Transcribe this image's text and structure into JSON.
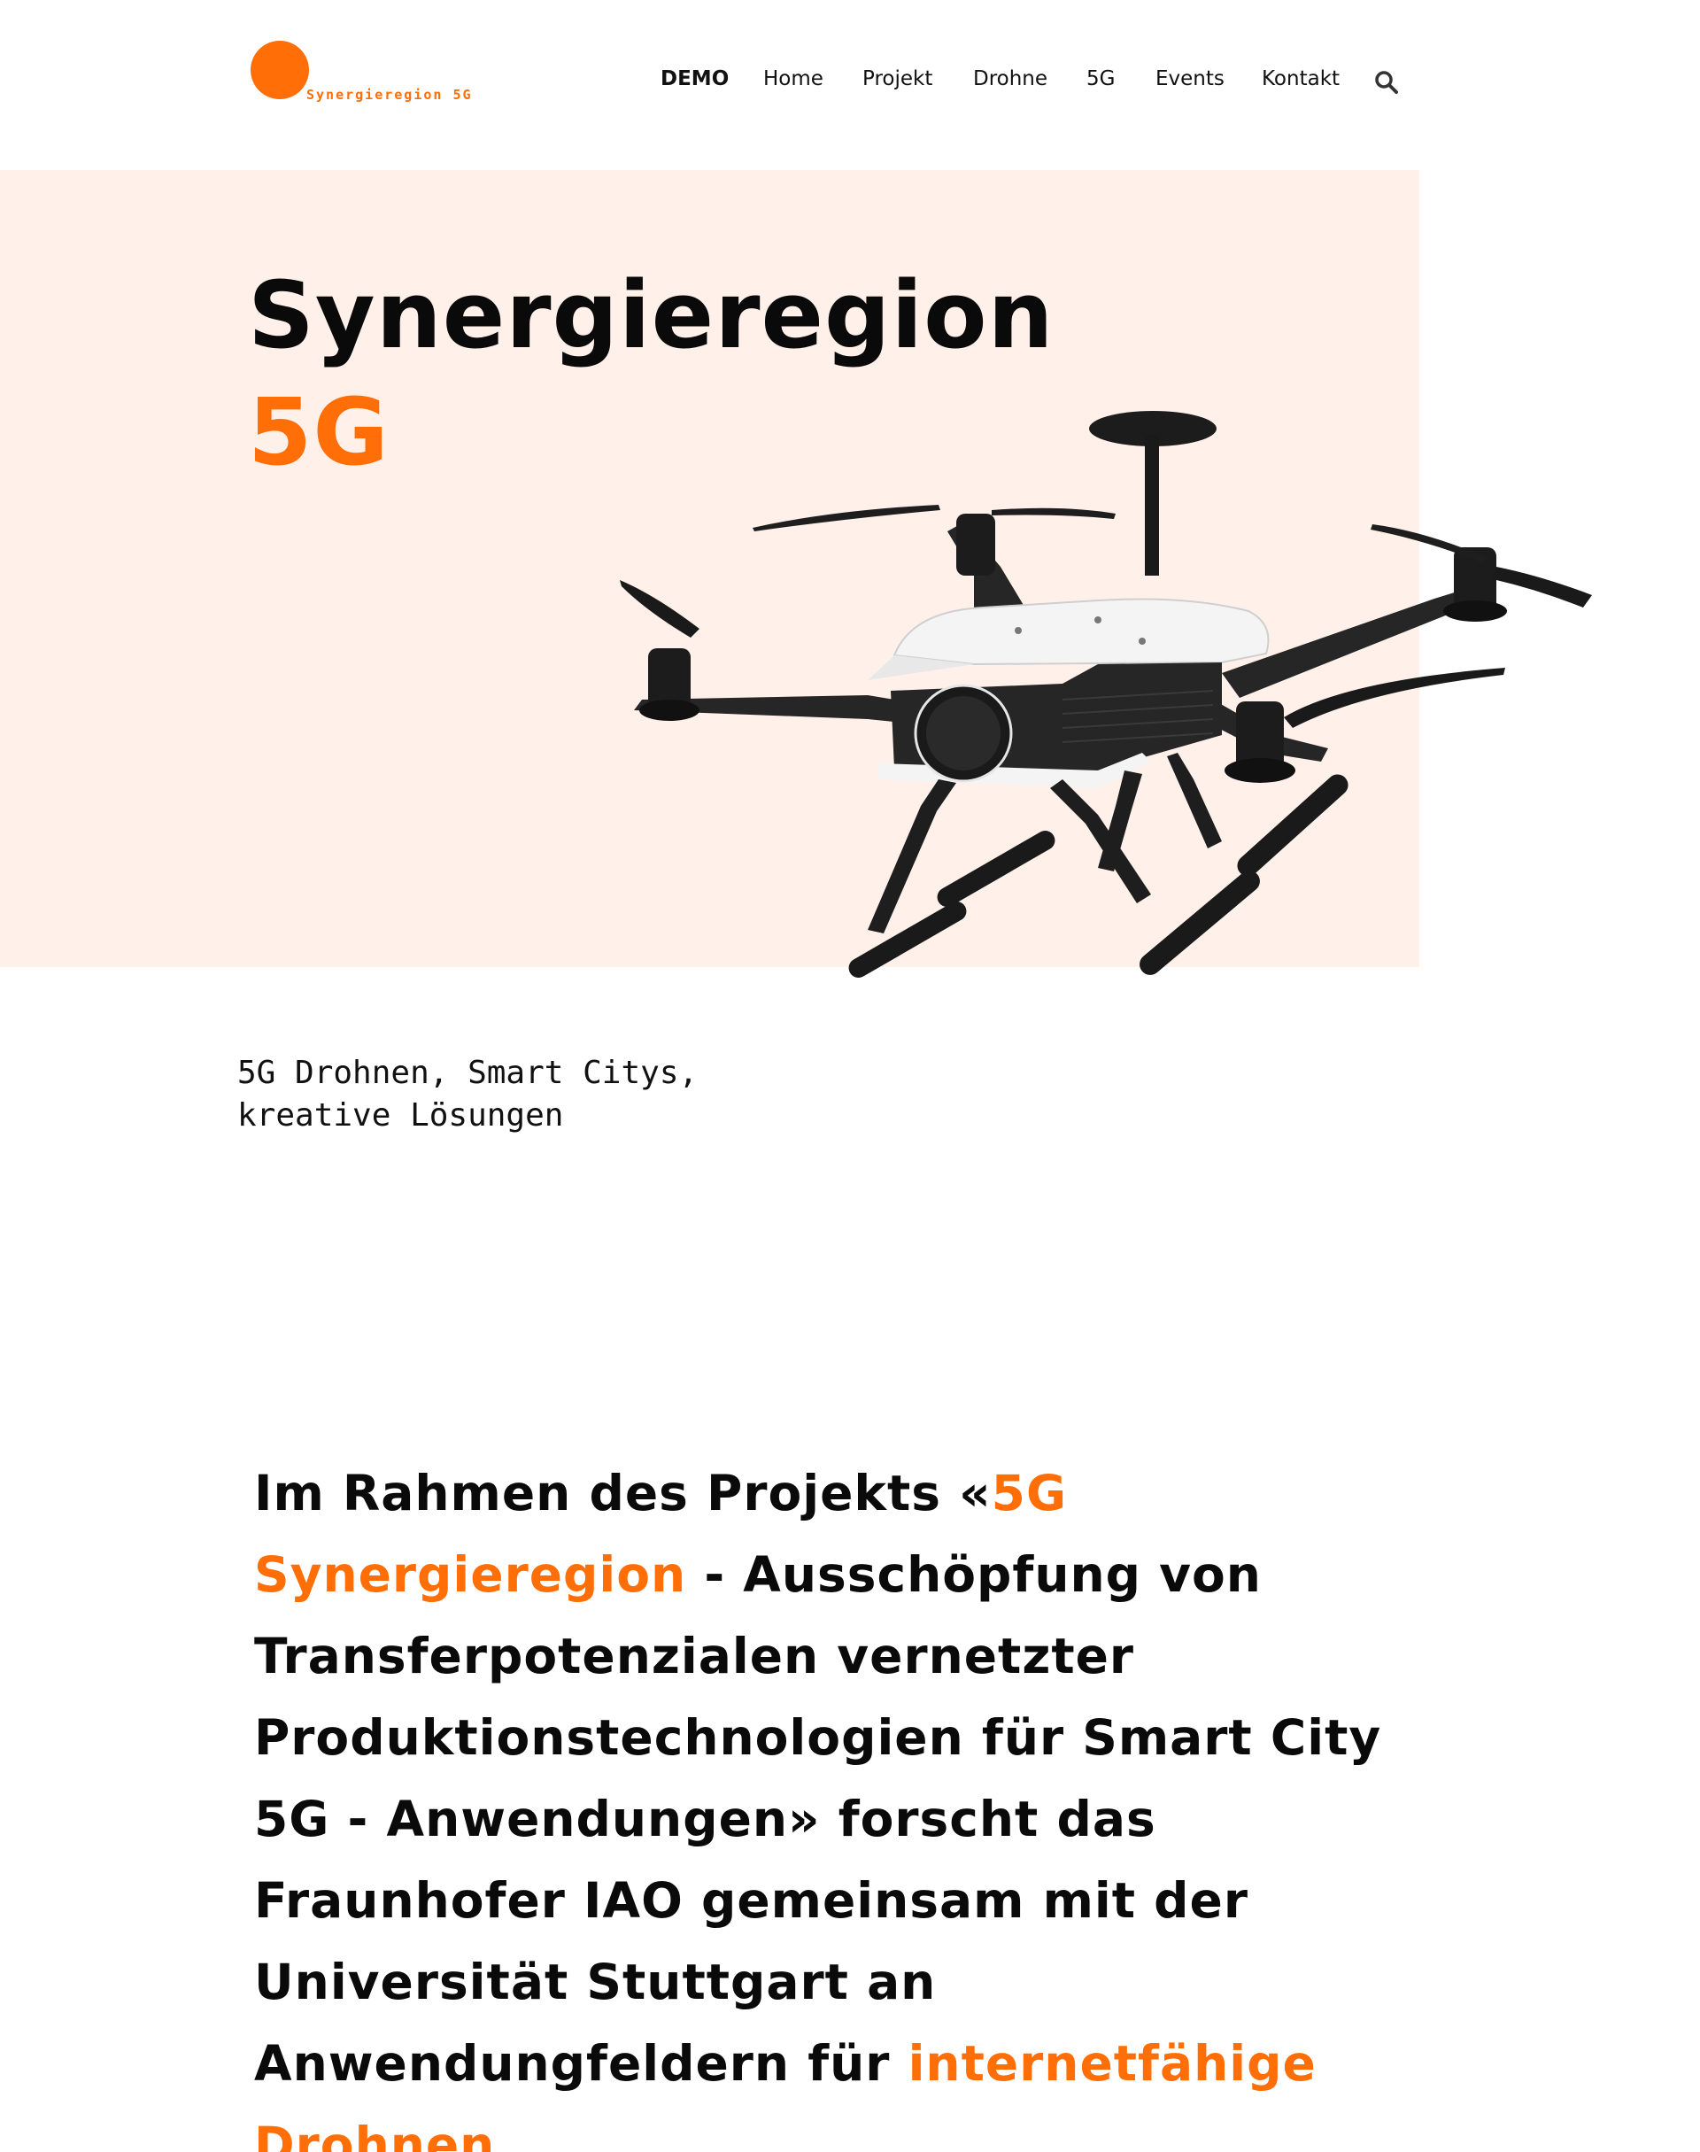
{
  "brand": {
    "name": "Synergieregion 5G",
    "accent_color": "#ff6e07",
    "hero_background": "#fff1ea"
  },
  "nav": {
    "items": [
      {
        "label": "DEMO",
        "active": true
      },
      {
        "label": "Home"
      },
      {
        "label": "Projekt"
      },
      {
        "label": "Drohne"
      },
      {
        "label": "5G"
      },
      {
        "label": "Events"
      },
      {
        "label": "Kontakt"
      }
    ],
    "search_icon": "search-icon"
  },
  "hero": {
    "title_line1": "Synergieregion",
    "title_line2": "5G",
    "image": "quadcopter-drone",
    "tagline_line1": "5G Drohnen, Smart Citys,",
    "tagline_line2": "kreative Lösungen"
  },
  "intro": {
    "part1": "Im Rahmen des Projekts «",
    "highlight1": "5G Synergieregion",
    "part2": " - Ausschöpfung von Transferpotenzialen vernetzter Produktionstechnologien für Smart City 5G - Anwendungen» forscht das Fraunhofer IAO gemeinsam mit der Universität Stuttgart an Anwendungfeldern für ",
    "highlight2": "internetfähige Drohnen",
    "part3": "."
  }
}
